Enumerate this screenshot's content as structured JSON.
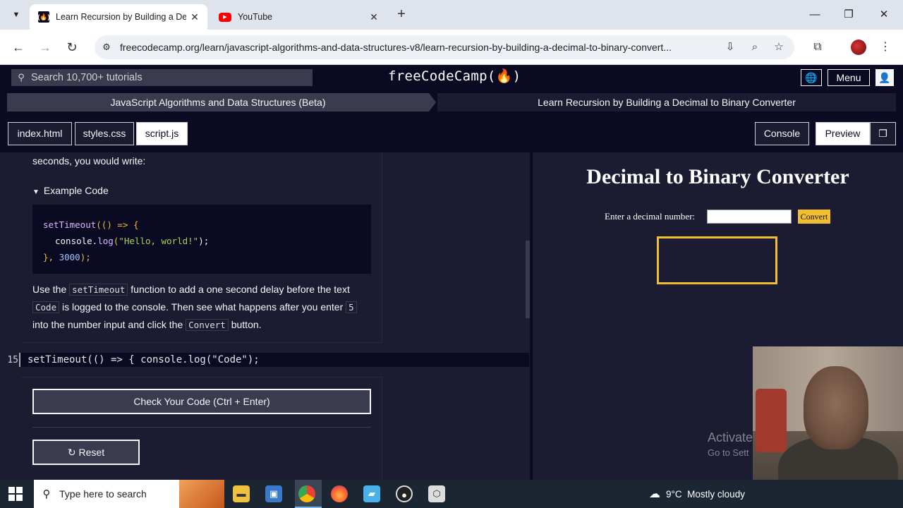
{
  "browser": {
    "tabs": [
      {
        "title": "Learn Recursion by Building a Dec",
        "favicon": "fcc-icon",
        "active": true
      },
      {
        "title": "YouTube",
        "favicon": "youtube-icon",
        "active": false
      }
    ],
    "new_tab": "+",
    "url": "freecodecamp.org/learn/javascript-algorithms-and-data-structures-v8/learn-recursion-by-building-a-decimal-to-binary-convert..."
  },
  "fcc_nav": {
    "search_placeholder": "Search 10,700+ tutorials",
    "logo": "freeCodeCamp(🔥)",
    "menu_label": "Menu"
  },
  "breadcrumb": {
    "superblock": "JavaScript Algorithms and Data Structures (Beta)",
    "block": "Learn Recursion by Building a Decimal to Binary Converter"
  },
  "file_tabs": [
    "index.html",
    "styles.css",
    "script.js"
  ],
  "active_file": "script.js",
  "right_tabs": {
    "console": "Console",
    "preview": "Preview"
  },
  "instructions": {
    "intro_tail": "seconds, you would write:",
    "example_summary": "Example Code",
    "para": {
      "t1": "Use the",
      "c1": "setTimeout",
      "t2": "function to add a one second delay before the text",
      "c2": "Code",
      "t3": "is logged to the console. Then see what happens after you enter",
      "c3": "5",
      "t4": "into the number input and click the",
      "c4": "Convert",
      "t5": "button."
    }
  },
  "example_code": {
    "l1_fn": "setTimeout",
    "l1_rest": "(() => {",
    "l2_obj": "console.",
    "l2_fn": "log",
    "l2_open": "(",
    "l2_str": "\"Hello, world!\"",
    "l2_close": ");",
    "l3_open": "}, ",
    "l3_num": "3000",
    "l3_close": ");"
  },
  "editor": {
    "line_number": "15",
    "line_code": "setTimeout(() => { console.log(\"Code\");"
  },
  "buttons": {
    "check": "Check Your Code (Ctrl + Enter)",
    "reset": "Reset"
  },
  "preview": {
    "title": "Decimal to Binary Converter",
    "input_label": "Enter a decimal number:",
    "convert_button": "Convert",
    "watermark_line1": "Activate",
    "watermark_line2": "Go to Sett"
  },
  "taskbar": {
    "search_placeholder": "Type here to search",
    "weather_temp": "9°C",
    "weather_desc": "Mostly cloudy"
  },
  "colors": {
    "fcc_dark": "#0a0a23",
    "fcc_bg": "#1b1b32",
    "accent_yellow": "#f1be32",
    "code_purple": "#dbb8ff",
    "code_green": "#acd157"
  }
}
